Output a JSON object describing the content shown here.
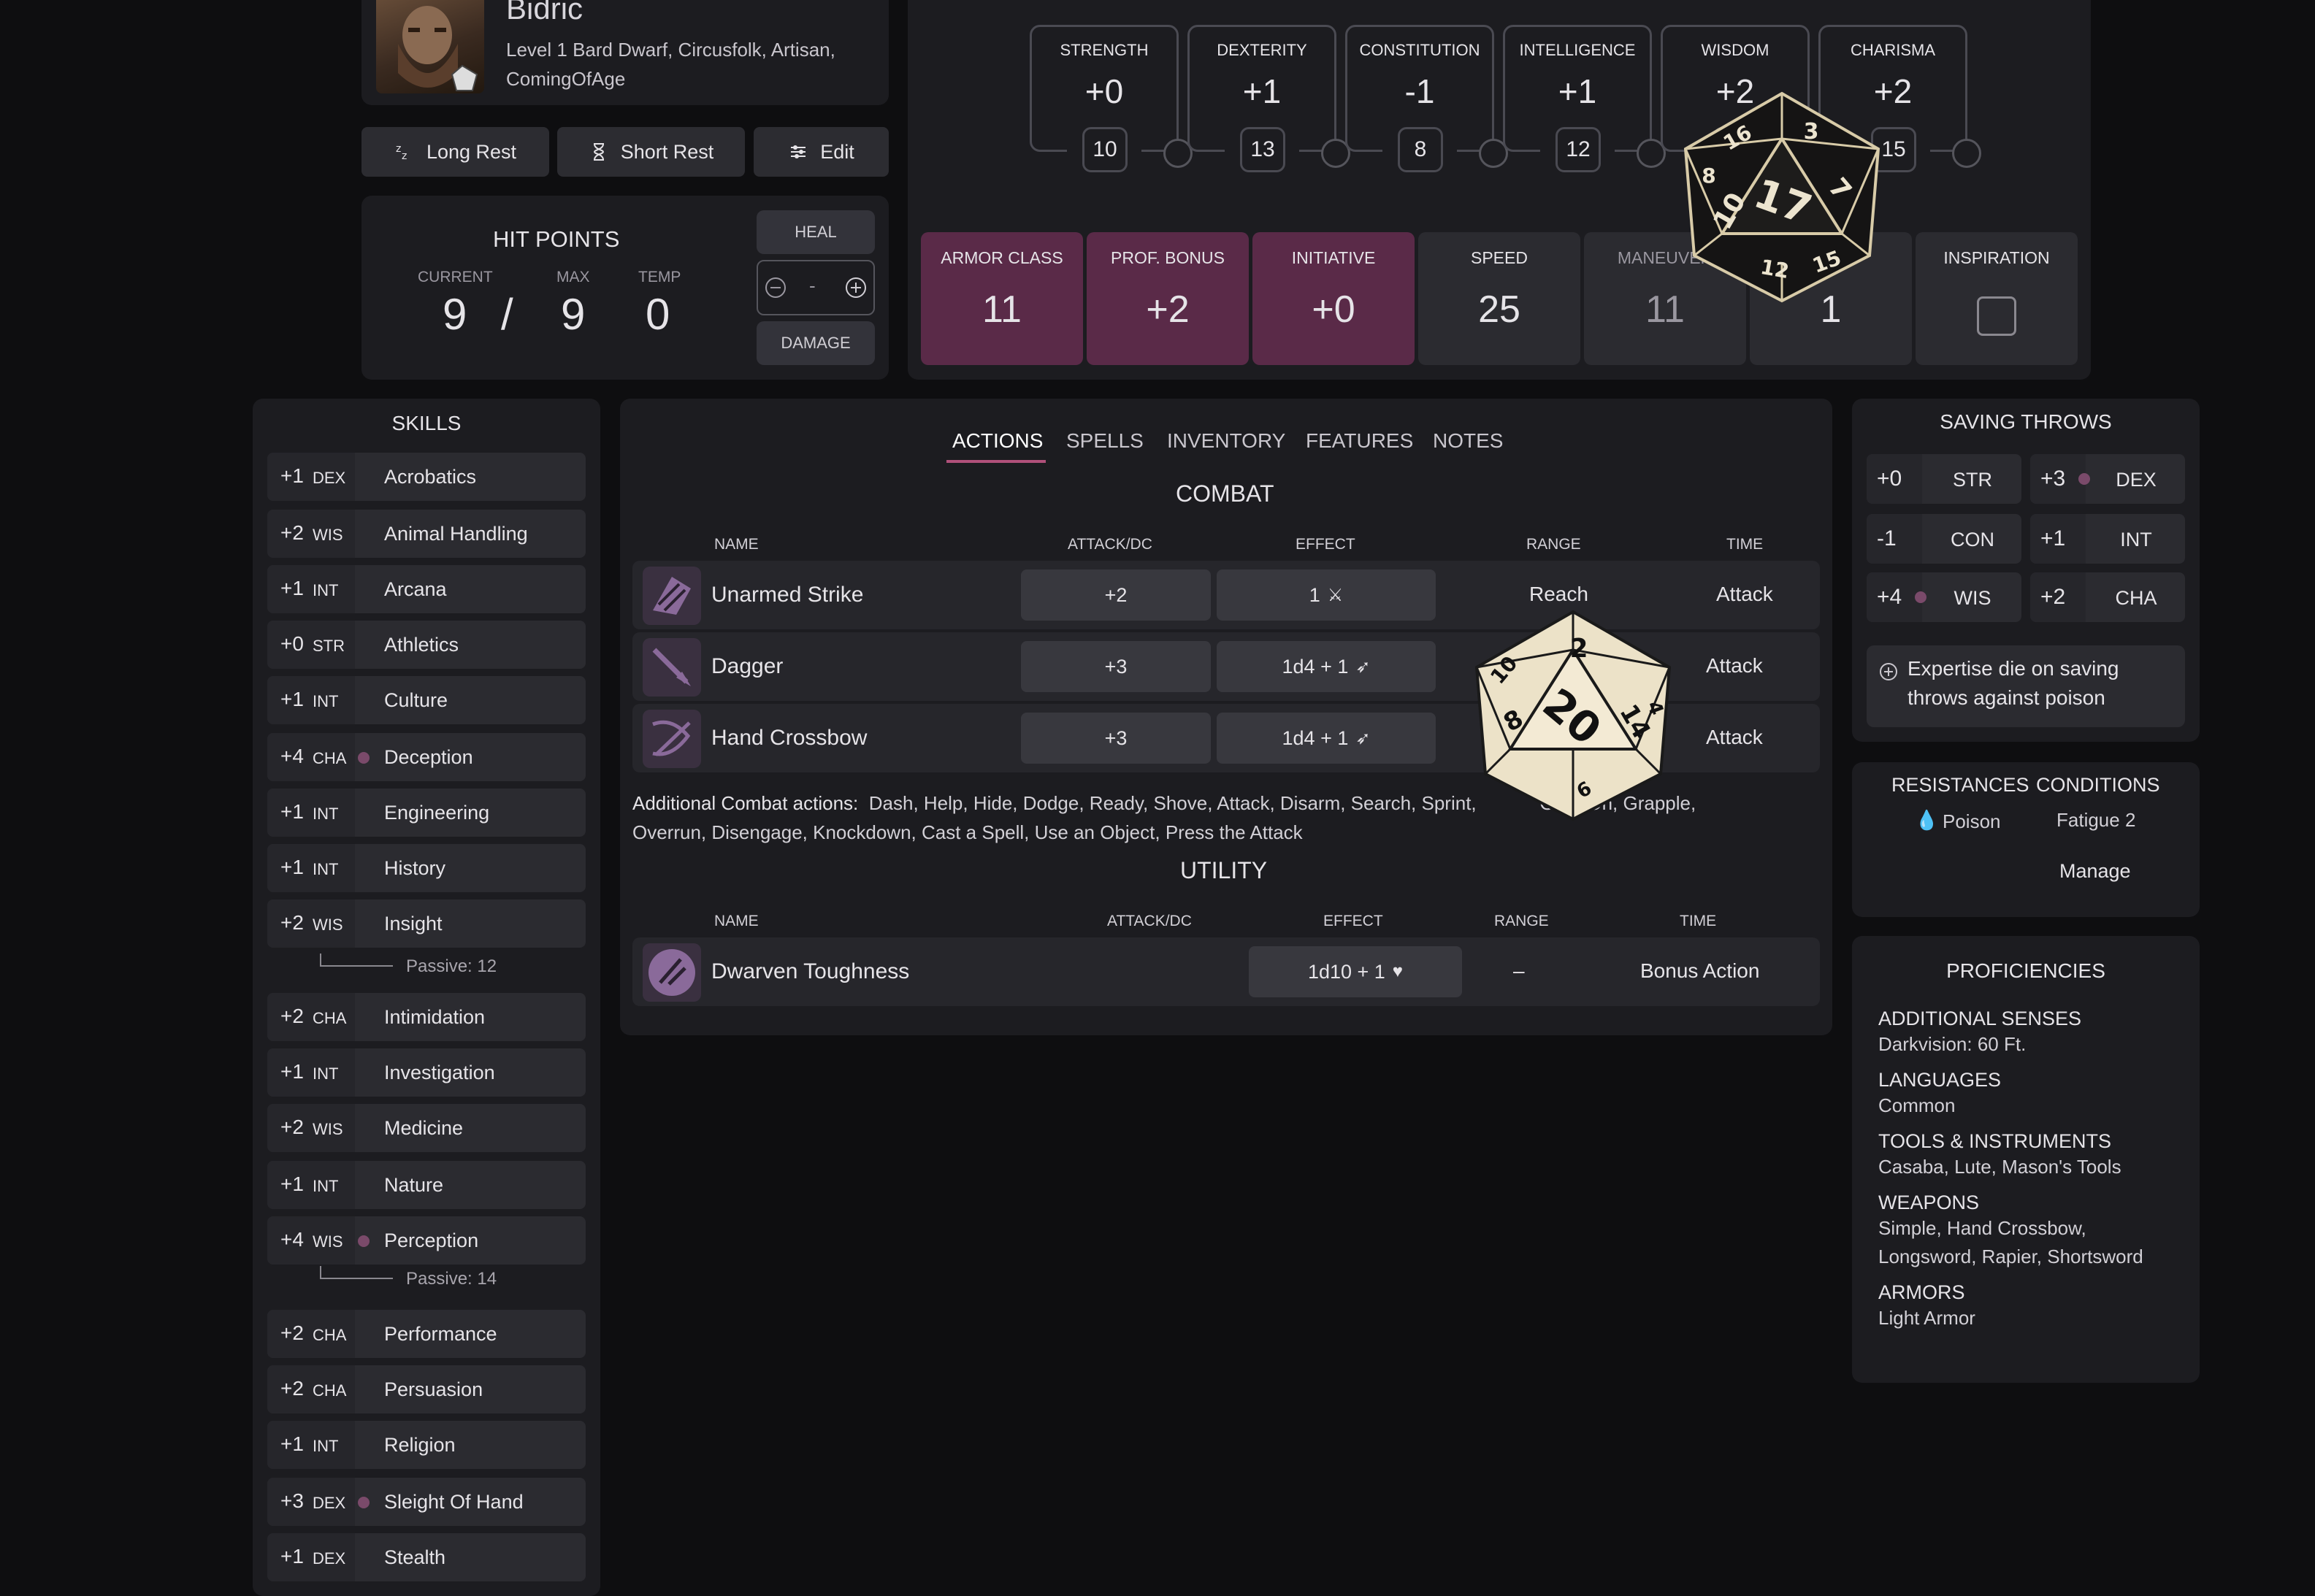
{
  "character": {
    "name": "Bidric",
    "subtitle_line1": "Level 1 Bard Dwarf, Circusfolk, Artisan,",
    "subtitle_line2": "ComingOfAge"
  },
  "rest": {
    "long_rest": "Long Rest",
    "short_rest": "Short Rest",
    "edit": "Edit"
  },
  "hit_points": {
    "title": "HIT POINTS",
    "current_label": "CURRENT",
    "max_label": "MAX",
    "temp_label": "TEMP",
    "current": "9",
    "separator": "/",
    "max": "9",
    "temp": "0",
    "heal": "HEAL",
    "damage": "DAMAGE",
    "input_value": "-"
  },
  "abilities": [
    {
      "name": "STRENGTH",
      "mod": "+0",
      "score": "10"
    },
    {
      "name": "DEXTERITY",
      "mod": "+1",
      "score": "13"
    },
    {
      "name": "CONSTITUTION",
      "mod": "-1",
      "score": "8"
    },
    {
      "name": "INTELLIGENCE",
      "mod": "+1",
      "score": "12"
    },
    {
      "name": "WISDOM",
      "mod": "+2",
      "score": ""
    },
    {
      "name": "CHARISMA",
      "mod": "+2",
      "score": "15"
    }
  ],
  "stats": [
    {
      "label": "ARMOR CLASS",
      "value": "11"
    },
    {
      "label": "PROF. BONUS",
      "value": "+2"
    },
    {
      "label": "INITIATIVE",
      "value": "+0"
    },
    {
      "label": "SPEED",
      "value": "25"
    },
    {
      "label": "MANEUVER",
      "value": "11"
    },
    {
      "label": "",
      "value": "1"
    },
    {
      "label": "INSPIRATION",
      "value": ""
    }
  ],
  "skills": {
    "title": "SKILLS",
    "items": [
      {
        "mod": "+1",
        "abbr": "DEX",
        "name": "Acrobatics",
        "prof": false
      },
      {
        "mod": "+2",
        "abbr": "WIS",
        "name": "Animal Handling",
        "prof": false
      },
      {
        "mod": "+1",
        "abbr": "INT",
        "name": "Arcana",
        "prof": false
      },
      {
        "mod": "+0",
        "abbr": "STR",
        "name": "Athletics",
        "prof": false
      },
      {
        "mod": "+1",
        "abbr": "INT",
        "name": "Culture",
        "prof": false
      },
      {
        "mod": "+4",
        "abbr": "CHA",
        "name": "Deception",
        "prof": true
      },
      {
        "mod": "+1",
        "abbr": "INT",
        "name": "Engineering",
        "prof": false
      },
      {
        "mod": "+1",
        "abbr": "INT",
        "name": "History",
        "prof": false
      },
      {
        "mod": "+2",
        "abbr": "WIS",
        "name": "Insight",
        "prof": false
      },
      {
        "mod": "+2",
        "abbr": "CHA",
        "name": "Intimidation",
        "prof": false
      },
      {
        "mod": "+1",
        "abbr": "INT",
        "name": "Investigation",
        "prof": false
      },
      {
        "mod": "+2",
        "abbr": "WIS",
        "name": "Medicine",
        "prof": false
      },
      {
        "mod": "+1",
        "abbr": "INT",
        "name": "Nature",
        "prof": false
      },
      {
        "mod": "+4",
        "abbr": "WIS",
        "name": "Perception",
        "prof": true
      },
      {
        "mod": "+2",
        "abbr": "CHA",
        "name": "Performance",
        "prof": false
      },
      {
        "mod": "+2",
        "abbr": "CHA",
        "name": "Persuasion",
        "prof": false
      },
      {
        "mod": "+1",
        "abbr": "INT",
        "name": "Religion",
        "prof": false
      },
      {
        "mod": "+3",
        "abbr": "DEX",
        "name": "Sleight Of Hand",
        "prof": true
      },
      {
        "mod": "+1",
        "abbr": "DEX",
        "name": "Stealth",
        "prof": false
      }
    ],
    "passive_insight": "Passive: 12",
    "passive_perception": "Passive: 14"
  },
  "tabs": [
    "ACTIONS",
    "SPELLS",
    "INVENTORY",
    "FEATURES",
    "NOTES"
  ],
  "combat": {
    "title": "COMBAT",
    "headers": {
      "name": "NAME",
      "attack": "ATTACK/DC",
      "effect": "EFFECT",
      "range": "RANGE",
      "time": "TIME"
    },
    "rows": [
      {
        "name": "Unarmed Strike",
        "attack": "+2",
        "effect": "1",
        "range": "Reach",
        "time": "Attack"
      },
      {
        "name": "Dagger",
        "attack": "+3",
        "effect": "1d4 + 1",
        "range": "",
        "time": "Attack"
      },
      {
        "name": "Hand Crossbow",
        "attack": "+3",
        "effect": "1d4 + 1",
        "range": "",
        "time": "Attack"
      }
    ],
    "additional_label": "Additional Combat actions:",
    "additional_line1": "Dash, Help, Hide, Dodge, Ready, Shove, Attack, Disarm, Search, Sprint,",
    "additional_line1b": "Grab On, Grapple,",
    "additional_line2": "Overrun, Disengage, Knockdown, Cast a Spell, Use an Object, Press the Attack"
  },
  "utility": {
    "title": "UTILITY",
    "headers": {
      "name": "NAME",
      "attack": "ATTACK/DC",
      "effect": "EFFECT",
      "range": "RANGE",
      "time": "TIME"
    },
    "rows": [
      {
        "name": "Dwarven Toughness",
        "attack": "",
        "effect": "1d10 + 1",
        "range": "–",
        "time": "Bonus Action"
      }
    ]
  },
  "saving_throws": {
    "title": "SAVING THROWS",
    "items": [
      {
        "mod": "+0",
        "abbr": "STR",
        "prof": false
      },
      {
        "mod": "+3",
        "abbr": "DEX",
        "prof": true
      },
      {
        "mod": "-1",
        "abbr": "CON",
        "prof": false
      },
      {
        "mod": "+1",
        "abbr": "INT",
        "prof": false
      },
      {
        "mod": "+4",
        "abbr": "WIS",
        "prof": true
      },
      {
        "mod": "+2",
        "abbr": "CHA",
        "prof": false
      }
    ],
    "note_line1": "Expertise die on saving",
    "note_line2": "throws against poison"
  },
  "resistances": {
    "res_title": "RESISTANCES",
    "cond_title": "CONDITIONS",
    "resistance": "Poison",
    "condition": "Fatigue 2",
    "manage": "Manage"
  },
  "proficiencies": {
    "title": "PROFICIENCIES",
    "senses_h": "ADDITIONAL SENSES",
    "senses_v": "Darkvision: 60 Ft.",
    "languages_h": "LANGUAGES",
    "languages_v": "Common",
    "tools_h": "TOOLS & INSTRUMENTS",
    "tools_v": "Casaba, Lute, Mason's Tools",
    "weapons_h": "WEAPONS",
    "weapons_v1": "Simple, Hand Crossbow,",
    "weapons_v2": "Longsword, Rapier, Shortsword",
    "armors_h": "ARMORS",
    "armors_v": "Light Armor"
  },
  "dice": {
    "dark_die": [
      "17",
      "7",
      "10",
      "8",
      "3",
      "16",
      "12",
      "15"
    ],
    "light_die": [
      "20",
      "2",
      "8",
      "14",
      "10",
      "4",
      "9"
    ]
  },
  "colors": {
    "background": "#0e0e10",
    "panel": "#1c1c20",
    "row": "#2b2b30",
    "accent": "#b0507a",
    "highlight_stat": "#5a2a48",
    "prof_dot": "#7a4a6a"
  }
}
